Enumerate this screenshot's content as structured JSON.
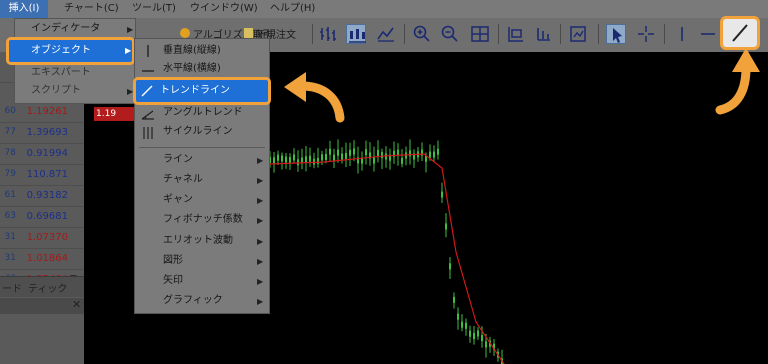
{
  "menubar": {
    "insert": "挿入(I)",
    "chart": "チャート(C)",
    "tools": "ツール(T)",
    "window": "ウインドウ(W)",
    "help": "ヘルプ(H)"
  },
  "toolbar": {
    "algo_label": "アルゴリズム取引",
    "new_order_label": "新規注文"
  },
  "insert_menu": {
    "indicators": "インディケータ",
    "objects": "オブジェクト",
    "experts": "エキスパート",
    "scripts": "スクリプト"
  },
  "objects_submenu": {
    "vertical_line": "垂直線(縦線)",
    "horizontal_line": "水平線(横線)",
    "trendline": "トレンドライン",
    "angle_trend": "アングルトレンド",
    "cycle_lines": "サイクルライン",
    "lines": "ライン",
    "channels": "チャネル",
    "gann": "ギャン",
    "fibonacci": "フィボナッチ係数",
    "elliott": "エリオット波動",
    "shapes": "図形",
    "arrows": "矢印",
    "graphics": "グラフィック"
  },
  "market_watch": {
    "rows": [
      {
        "sym": "60",
        "ask": "1.19261",
        "color": "red"
      },
      {
        "sym": "77",
        "ask": "1.39693",
        "color": "blue"
      },
      {
        "sym": "78",
        "ask": "0.91994",
        "color": "blue"
      },
      {
        "sym": "79",
        "ask": "110.871",
        "color": "blue"
      },
      {
        "sym": "61",
        "ask": "0.93182",
        "color": "blue"
      },
      {
        "sym": "63",
        "ask": "0.69681",
        "color": "blue"
      },
      {
        "sym": "31",
        "ask": "1.07370",
        "color": "red"
      },
      {
        "sym": "31",
        "ask": "1.01864",
        "color": "red"
      },
      {
        "sym": "46",
        "ask": "1.57464",
        "color": "red"
      }
    ],
    "tab_left": "ード",
    "tab_tick": "ティック"
  },
  "chart": {
    "price_label": "1.19"
  },
  "colors": {
    "highlight_outline": "#f2a23a",
    "selection_blue": "#1e6fd6",
    "candle_green": "#3fbf3f",
    "ma_red": "#d01818"
  }
}
